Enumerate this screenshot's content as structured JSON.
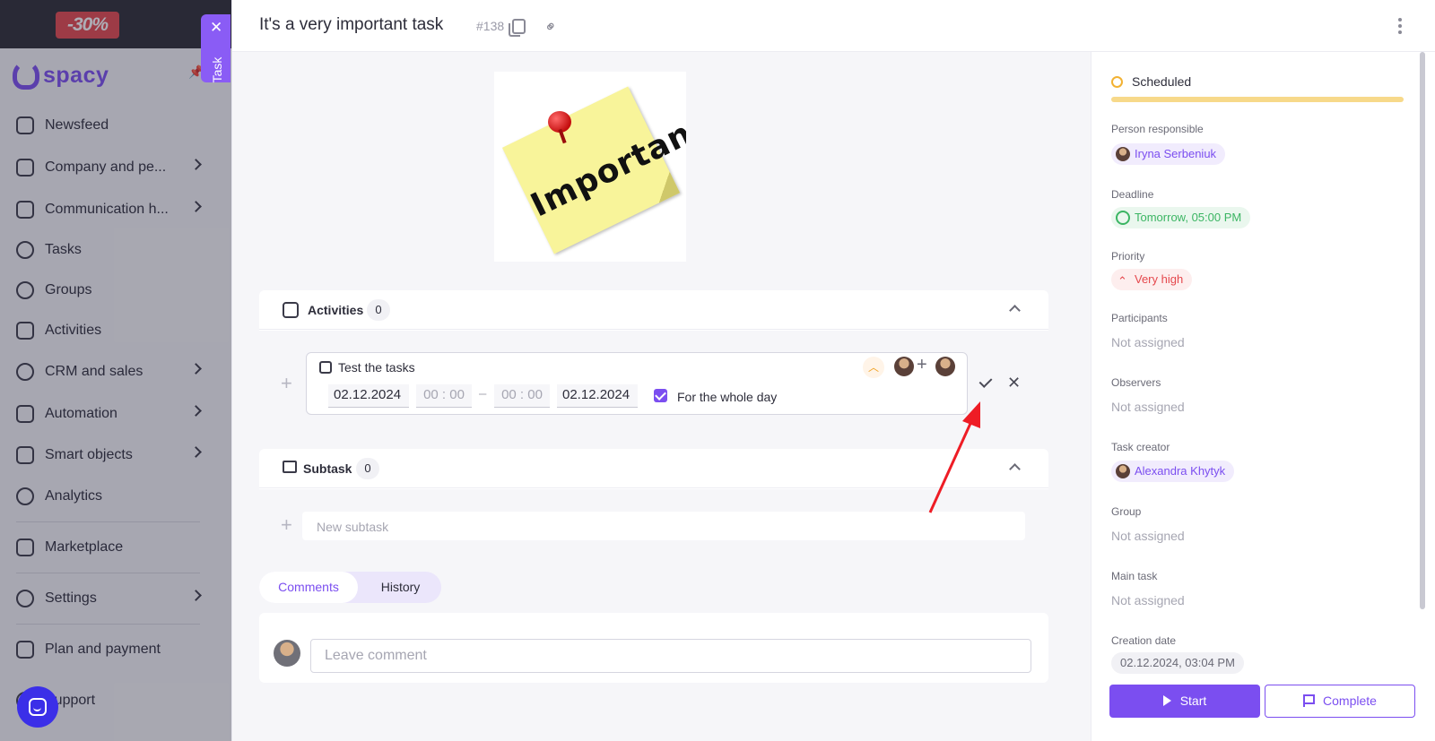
{
  "promo": {
    "badge": "-30%"
  },
  "logo": {
    "text": "spacy"
  },
  "sidebar": {
    "items": [
      {
        "label": "Newsfeed"
      },
      {
        "label": "Company and pe..."
      },
      {
        "label": "Communication h..."
      },
      {
        "label": "Tasks"
      },
      {
        "label": "Groups"
      },
      {
        "label": "Activities"
      },
      {
        "label": "CRM and sales"
      },
      {
        "label": "Automation"
      },
      {
        "label": "Smart objects"
      },
      {
        "label": "Analytics"
      },
      {
        "label": "Marketplace"
      },
      {
        "label": "Settings"
      },
      {
        "label": "Plan and payment"
      },
      {
        "label": "Support"
      }
    ]
  },
  "task_tab": {
    "label": "Task",
    "close": "✕"
  },
  "header": {
    "title": "It's a very important task",
    "task_id": "#138"
  },
  "image": {
    "text": "Important"
  },
  "activities": {
    "title": "Activities",
    "count": "0",
    "edit": {
      "name": "Test the tasks",
      "start_date": "02.12.2024",
      "start_time": "00 : 00",
      "end_time": "00 : 00",
      "end_date": "02.12.2024",
      "dash": "–",
      "whole_day_label": "For the whole day"
    }
  },
  "subtask": {
    "title": "Subtask",
    "count": "0",
    "placeholder": "New subtask"
  },
  "tabs": {
    "comments": "Comments",
    "history": "History"
  },
  "comment": {
    "placeholder": "Leave comment"
  },
  "side": {
    "status": "Scheduled",
    "person_responsible": {
      "label": "Person responsible",
      "value": "Iryna Serbeniuk"
    },
    "deadline": {
      "label": "Deadline",
      "value": "Tomorrow, 05:00 PM"
    },
    "priority": {
      "label": "Priority",
      "value": "Very high"
    },
    "participants": {
      "label": "Participants",
      "value": "Not assigned"
    },
    "observers": {
      "label": "Observers",
      "value": "Not assigned"
    },
    "task_creator": {
      "label": "Task creator",
      "value": "Alexandra Khytyk"
    },
    "group": {
      "label": "Group",
      "value": "Not assigned"
    },
    "main_task": {
      "label": "Main task",
      "value": "Not assigned"
    },
    "creation_date": {
      "label": "Creation date",
      "value": "02.12.2024, 03:04 PM"
    },
    "start_button": "Start",
    "complete_button": "Complete"
  },
  "colors": {
    "accent": "#7b4ef0",
    "danger": "#e5484d",
    "success": "#3bb563",
    "warning": "#f2b233"
  }
}
